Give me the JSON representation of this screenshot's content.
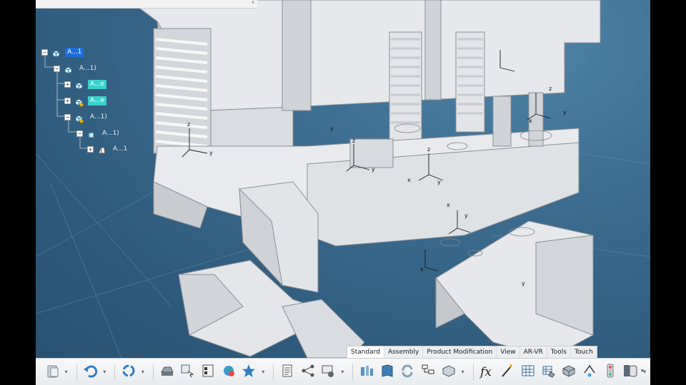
{
  "spec_tree": {
    "nodes": [
      {
        "label": "A...1",
        "state": "selected",
        "expander": "−",
        "icon": "product-icon"
      },
      {
        "label": "A...1)",
        "state": "normal",
        "expander": "−",
        "icon": "product-icon"
      },
      {
        "label": "A...e",
        "state": "highlight",
        "expander": "+",
        "icon": "product-icon"
      },
      {
        "label": "A...e",
        "state": "highlight",
        "expander": "+",
        "icon": "product-flex-icon"
      },
      {
        "label": "A...1)",
        "state": "normal",
        "expander": "−",
        "icon": "product-flex-icon"
      },
      {
        "label": "A...1)",
        "state": "normal",
        "expander": "−",
        "icon": "part-icon"
      },
      {
        "label": "A...1",
        "state": "normal",
        "expander": "+",
        "icon": "part-body-icon"
      }
    ]
  },
  "top_scroll": {
    "arrow": "‹"
  },
  "workbench_tabs": [
    {
      "label": "Standard",
      "active": true
    },
    {
      "label": "Assembly",
      "active": false
    },
    {
      "label": "Product Modification",
      "active": false
    },
    {
      "label": "View",
      "active": false
    },
    {
      "label": "AR-VR",
      "active": false
    },
    {
      "label": "Tools",
      "active": false
    },
    {
      "label": "Touch",
      "active": false
    }
  ],
  "toolbar": {
    "icons": [
      "paste-icon",
      "undo-icon",
      "update-icon",
      "save-management-icon",
      "select-icon",
      "catalog-icon",
      "globe-icon",
      "star-icon",
      "list-icon",
      "graph-tree-icon",
      "settings-icon",
      "explode-icon",
      "book-icon",
      "refresh-icon",
      "tree-view-icon",
      "cube-stack-icon",
      "formula-icon",
      "magic-wand-icon",
      "table-icon",
      "design-table-icon",
      "measure-icon",
      "draw-icon",
      "traffic-light-icon",
      "database-icon"
    ],
    "more_glyph": "▸"
  },
  "axis_labels": {
    "z": "z",
    "y": "y",
    "x": "x"
  },
  "colors": {
    "background_top": "#4f85a8",
    "background_bottom": "#2a5272",
    "part_fill": "#e4e6e9",
    "selected": "#1c6fd8",
    "highlight": "#3ad1c9"
  }
}
